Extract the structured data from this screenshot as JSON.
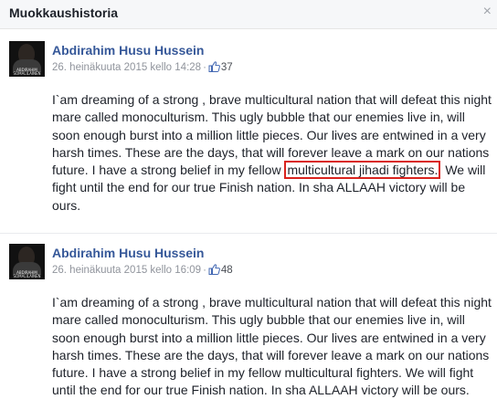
{
  "dialog": {
    "title": "Muokkaushistoria",
    "close_label": "×"
  },
  "revisions": [
    {
      "author": "Abdirahim Husu Hussein",
      "avatar_caption": "ABDIRAHIM SOMALILAINEN",
      "date": "26. heinäkuuta 2015 kello 14:28",
      "separator": "·",
      "likes": "37",
      "text_before": "I`am dreaming of a strong , brave multicultural nation that will defeat this night mare called monoculturism. This ugly bubble that our enemies live in, will soon enough burst into a million little pieces. Our lives are entwined in a very harsh times. These are the days, that will forever leave a mark on our nations future. I have a strong belief in my fellow ",
      "text_highlight": "multicultural jihadi fighters.",
      "text_after": " We will fight until the end for our true Finish nation. In sha ALLAAH victory will be ours."
    },
    {
      "author": "Abdirahim Husu Hussein",
      "avatar_caption": "ABDIRAHIM SOMALILAINEN",
      "date": "26. heinäkuuta 2015 kello 16:09",
      "separator": "·",
      "likes": "48",
      "text": "I`am dreaming of a strong , brave multicultural nation that will defeat this night mare called monoculturism. This ugly bubble that our enemies live in, will soon enough burst into a million little pieces. Our lives are entwined in a very harsh times. These are the days, that will forever leave a mark on our nations future. I have a strong belief in my fellow multicultural fighters. We will fight until the end for our true Finish nation. In sha ALLAAH victory will be ours."
    }
  ],
  "colors": {
    "link": "#365899",
    "meta": "#90949c",
    "highlight_border": "#d9231e"
  }
}
